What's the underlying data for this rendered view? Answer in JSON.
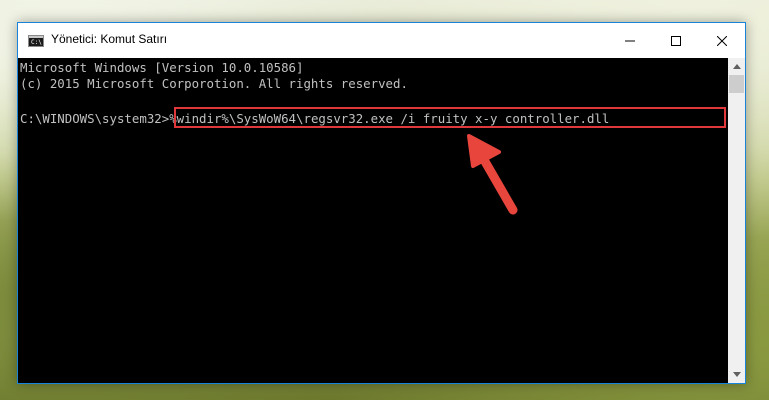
{
  "window": {
    "title": "Yönetici: Komut Satırı",
    "app_icon_label": "C:\\"
  },
  "console": {
    "lines": [
      "Microsoft Windows [Version 10.0.10586]",
      "(c) 2015 Microsoft Corporotion. All rights reserved."
    ],
    "prompt": "C:\\WINDOWS\\system32>",
    "command": "%windir%\\SysWoW64\\regsvr32.exe /i fruity x-y controller.dll"
  },
  "icons": {
    "minimize": "minimize-icon",
    "maximize": "maximize-icon",
    "close": "close-icon",
    "annotation_arrow": "red-arrow-icon"
  },
  "colors": {
    "console_bg": "#000000",
    "console_text": "#c0c0c0",
    "highlight": "#e0383a",
    "window_border": "#1883d7"
  }
}
